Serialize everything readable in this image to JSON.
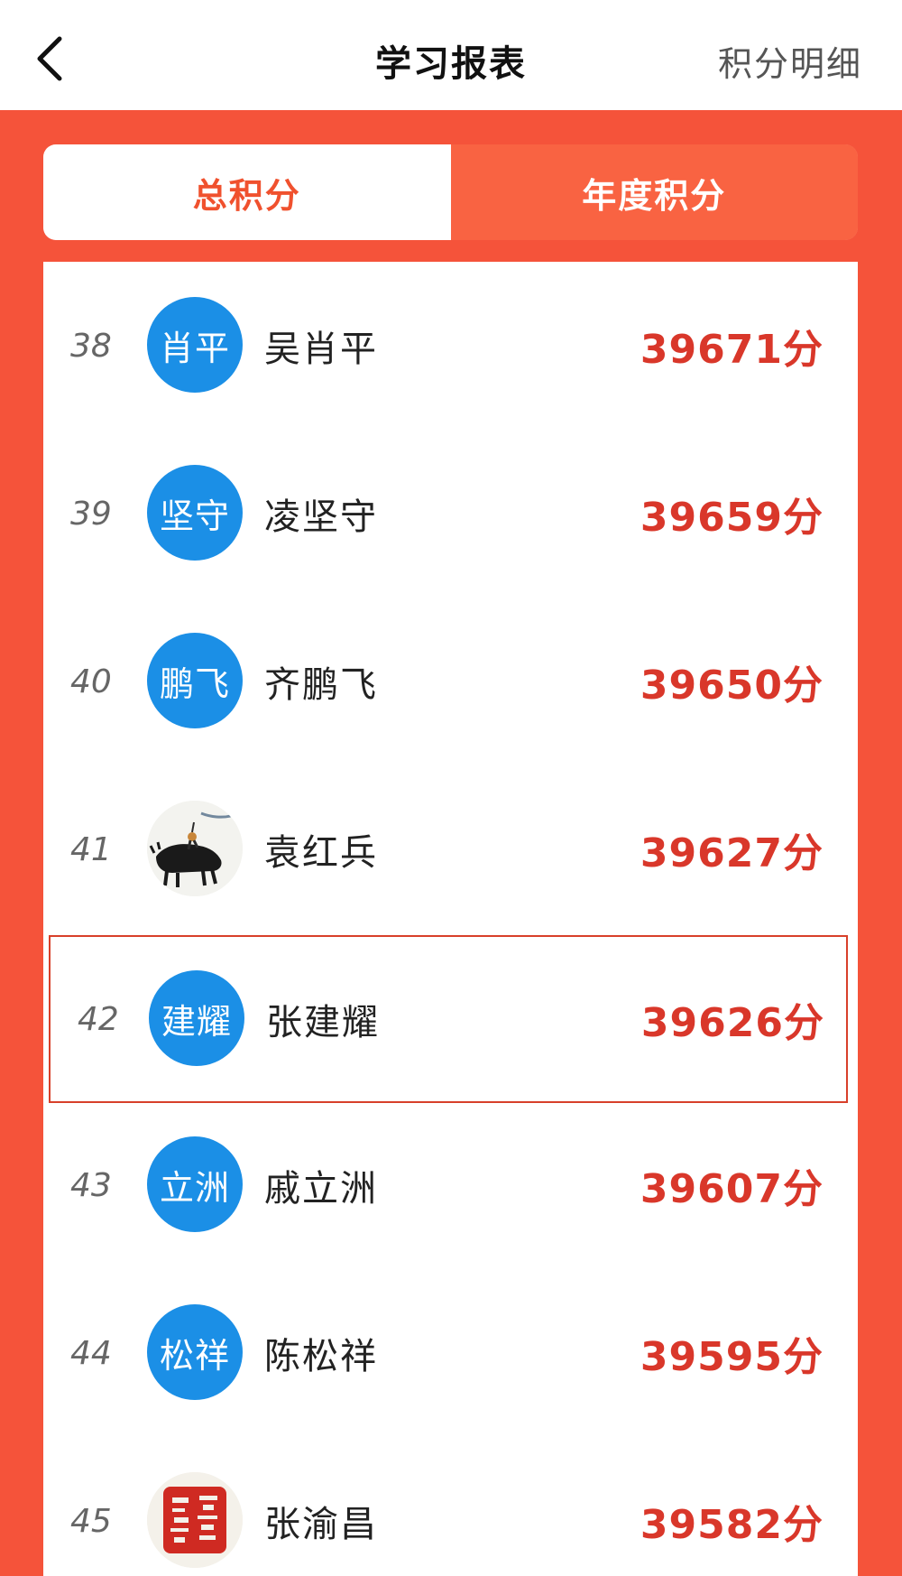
{
  "header": {
    "title": "学习报表",
    "right_link": "积分明细"
  },
  "tabs": [
    {
      "label": "总积分",
      "selected": false
    },
    {
      "label": "年度积分",
      "selected": true
    }
  ],
  "rows": [
    {
      "rank": "38",
      "avatar_text": "肖平",
      "name": "吴肖平",
      "score": "39671分"
    },
    {
      "rank": "39",
      "avatar_text": "坚守",
      "name": "凌坚守",
      "score": "39659分"
    },
    {
      "rank": "40",
      "avatar_text": "鹏飞",
      "name": "齐鹏飞",
      "score": "39650分"
    },
    {
      "rank": "41",
      "avatar_text": "",
      "avatar_icon": "ink-painting-buffalo-icon",
      "name": "袁红兵",
      "score": "39627分"
    },
    {
      "rank": "42",
      "avatar_text": "建耀",
      "name": "张建耀",
      "score": "39626分",
      "highlighted": true
    },
    {
      "rank": "43",
      "avatar_text": "立洲",
      "name": "戚立洲",
      "score": "39607分"
    },
    {
      "rank": "44",
      "avatar_text": "松祥",
      "name": "陈松祥",
      "score": "39595分"
    },
    {
      "rank": "45",
      "avatar_text": "",
      "avatar_icon": "red-seal-stamp-icon",
      "name": "张渝昌",
      "score": "39582分"
    }
  ],
  "colors": {
    "accent_red": "#f5533a",
    "score_red": "#d9372a",
    "avatar_blue": "#1b8fe6"
  }
}
